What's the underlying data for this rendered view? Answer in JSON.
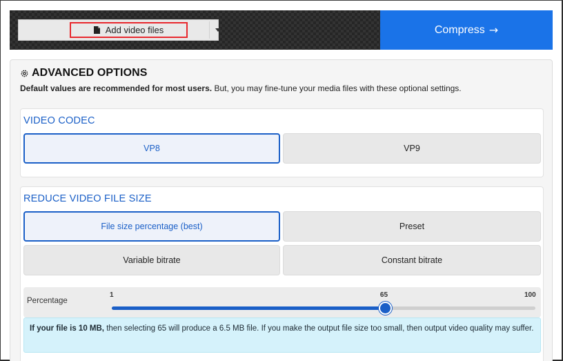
{
  "toolbar": {
    "add_files_label": "Add video files",
    "add_files_icon": "file-icon",
    "dropdown_icon": "caret-down-icon",
    "compress_label": "Compress",
    "compress_arrow": "→",
    "compress_color": "#1a73e8",
    "highlight_color": "#e8272d"
  },
  "advanced": {
    "title": "ADVANCED OPTIONS",
    "title_icon": "gear-icon",
    "desc_bold": "Default values are recommended for most users.",
    "desc_rest": " But, you may fine-tune your media files with these optional settings."
  },
  "video_codec": {
    "title": "VIDEO CODEC",
    "options": [
      {
        "label": "VP8",
        "selected": true
      },
      {
        "label": "VP9",
        "selected": false
      }
    ]
  },
  "reduce": {
    "title": "REDUCE VIDEO FILE SIZE",
    "options": [
      {
        "label": "File size percentage (best)",
        "selected": true
      },
      {
        "label": "Preset",
        "selected": false
      },
      {
        "label": "Variable bitrate",
        "selected": false
      },
      {
        "label": "Constant bitrate",
        "selected": false
      }
    ],
    "slider": {
      "label": "Percentage",
      "min": 1,
      "max": 100,
      "value": 65,
      "min_label": "1",
      "value_label": "65",
      "max_label": "100"
    },
    "info_bold": "If your file is 10 MB,",
    "info_rest": " then selecting 65 will produce a 6.5 MB file. If you make the output file size too small, then output video quality may suffer."
  },
  "accent_color": "#1a5fc7"
}
